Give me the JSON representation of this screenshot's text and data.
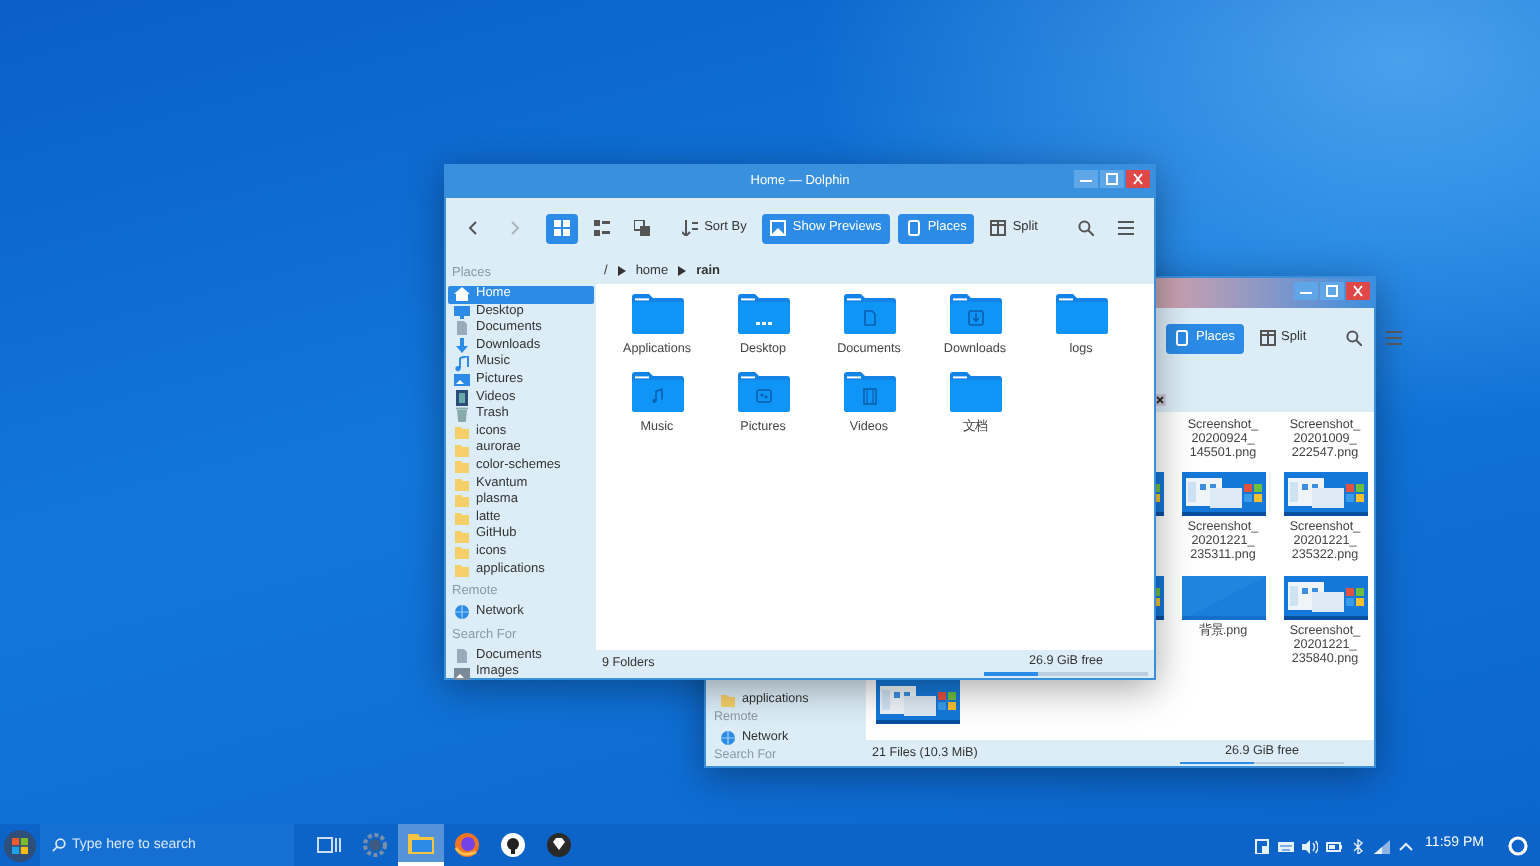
{
  "back_window": {
    "toolbar": [
      {
        "kind": "places",
        "label": "Places",
        "selected": true
      },
      {
        "kind": "split",
        "label": "Split",
        "selected": false
      },
      {
        "kind": "search"
      },
      {
        "kind": "menu"
      }
    ],
    "sidebar": [
      {
        "kind": "folder",
        "label": "applications"
      },
      {
        "kind": "heading",
        "label": "Remote"
      },
      {
        "kind": "network",
        "label": "Network"
      },
      {
        "kind": "heading",
        "label": "Search For"
      }
    ],
    "rows": [
      [
        null,
        null,
        null,
        {
          "kind": "name-only",
          "name_lines": [
            "Screenshot_",
            "20200924_",
            "145501.png"
          ]
        },
        {
          "kind": "name-only",
          "name_lines": [
            "Screenshot_",
            "20201009_",
            "222547.png"
          ]
        }
      ],
      [
        null,
        null,
        {
          "kind": "screenshot"
        },
        {
          "kind": "screenshot",
          "name_lines": [
            "Screenshot_",
            "20201221_",
            "235311.png"
          ]
        },
        {
          "kind": "screenshot",
          "name_lines": [
            "Screenshot_",
            "20201221_",
            "235322.png"
          ]
        }
      ],
      [
        null,
        null,
        {
          "kind": "screenshot"
        },
        {
          "kind": "plain",
          "name_lines": [
            "背景.png"
          ]
        },
        {
          "kind": "screenshot",
          "name_lines": [
            "Screenshot_",
            "20201221_",
            "235840.png"
          ]
        }
      ],
      [
        {
          "kind": "screenshot"
        },
        null,
        null,
        null,
        null
      ]
    ],
    "status": {
      "text": "21 Files (10.3 MiB)",
      "free": "26.9 GiB free",
      "level": 0.45
    }
  },
  "front_window": {
    "title": "Home — Dolphin",
    "toolbar": [
      {
        "kind": "back",
        "disabled": false
      },
      {
        "kind": "forward",
        "disabled": true
      },
      {
        "kind": "view-icons",
        "selected": true
      },
      {
        "kind": "view-compact",
        "selected": false
      },
      {
        "kind": "view-details",
        "selected": false
      },
      {
        "kind": "sort",
        "label": "Sort By",
        "selected": false
      },
      {
        "kind": "previews",
        "label": "Show Previews",
        "selected": true
      },
      {
        "kind": "places",
        "label": "Places",
        "selected": true
      },
      {
        "kind": "split",
        "label": "Split",
        "selected": false
      },
      {
        "kind": "search"
      },
      {
        "kind": "menu"
      }
    ],
    "breadcrumb": [
      {
        "label": "/",
        "selected": false
      },
      {
        "label": "home",
        "selected": false
      },
      {
        "label": "rain",
        "selected": true
      }
    ],
    "sidebar": [
      {
        "heading": "Places",
        "items": [
          {
            "kind": "home",
            "label": "Home",
            "selected": true
          },
          {
            "kind": "desktop",
            "label": "Desktop",
            "selected": false
          },
          {
            "kind": "documents",
            "label": "Documents",
            "selected": false
          },
          {
            "kind": "downloads",
            "label": "Downloads",
            "selected": false
          },
          {
            "kind": "music",
            "label": "Music",
            "selected": false
          },
          {
            "kind": "pictures",
            "label": "Pictures",
            "selected": false
          },
          {
            "kind": "videos",
            "label": "Videos",
            "selected": false
          },
          {
            "kind": "trash",
            "label": "Trash",
            "selected": false
          },
          {
            "kind": "folder",
            "label": "icons",
            "selected": false
          },
          {
            "kind": "folder",
            "label": "aurorae",
            "selected": false
          },
          {
            "kind": "folder",
            "label": "color-schemes",
            "selected": false
          },
          {
            "kind": "folder",
            "label": "Kvantum",
            "selected": false
          },
          {
            "kind": "folder",
            "label": "plasma",
            "selected": false
          },
          {
            "kind": "folder",
            "label": "latte",
            "selected": false
          },
          {
            "kind": "folder",
            "label": "GitHub",
            "selected": false
          },
          {
            "kind": "folder",
            "label": "icons",
            "selected": false
          },
          {
            "kind": "folder",
            "label": "applications",
            "selected": false
          }
        ]
      },
      {
        "heading": "Remote",
        "items": [
          {
            "kind": "network",
            "label": "Network",
            "selected": false
          }
        ]
      },
      {
        "heading": "Search For",
        "items": [
          {
            "kind": "search-documents",
            "label": "Documents",
            "selected": false
          },
          {
            "kind": "search-images",
            "label": "Images",
            "selected": false
          }
        ]
      }
    ],
    "files": [
      {
        "kind": "plain",
        "name": "Applications"
      },
      {
        "kind": "desktop",
        "name": "Desktop"
      },
      {
        "kind": "documents",
        "name": "Documents"
      },
      {
        "kind": "downloads",
        "name": "Downloads"
      },
      {
        "kind": "plain",
        "name": "logs"
      },
      {
        "kind": "music",
        "name": "Music"
      },
      {
        "kind": "pictures",
        "name": "Pictures"
      },
      {
        "kind": "videos",
        "name": "Videos"
      },
      {
        "kind": "plain",
        "name": "文档"
      }
    ],
    "status": {
      "text": "9 Folders",
      "free": "26.9 GiB free",
      "level": 0.33
    }
  },
  "taskbar": {
    "search": {
      "placeholder": "Type here to search"
    },
    "apps": [
      {
        "kind": "task-view",
        "selected": false
      },
      {
        "kind": "settings",
        "selected": false
      },
      {
        "kind": "files",
        "selected": true
      },
      {
        "kind": "firefox",
        "selected": false
      },
      {
        "kind": "github",
        "selected": false
      },
      {
        "kind": "diamond",
        "selected": false
      }
    ],
    "tray": [
      {
        "kind": "clipboard"
      },
      {
        "kind": "keyboard"
      },
      {
        "kind": "volume"
      },
      {
        "kind": "battery"
      },
      {
        "kind": "bluetooth"
      },
      {
        "kind": "network"
      },
      {
        "kind": "expand"
      }
    ],
    "clock": "11:59 PM"
  }
}
